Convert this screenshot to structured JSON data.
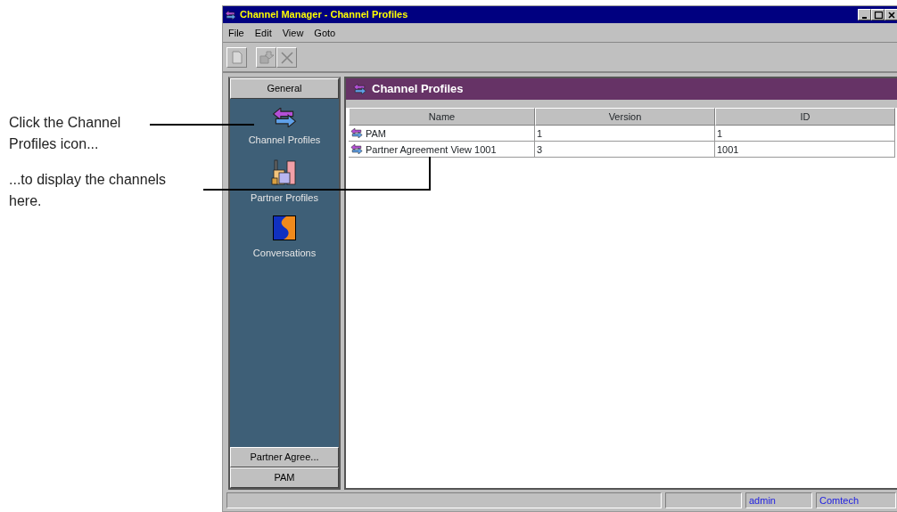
{
  "annotations": [
    {
      "text": "Click the Channel Profiles icon..."
    },
    {
      "text": "...to display the channels here."
    }
  ],
  "window": {
    "title": "Channel Manager - Channel Profiles"
  },
  "menu": [
    "File",
    "Edit",
    "View",
    "Goto"
  ],
  "toolbar": [
    {
      "kind": "new",
      "disabled": true
    },
    {
      "kind": "export",
      "disabled": true
    },
    {
      "kind": "delete",
      "disabled": true
    }
  ],
  "sidebar": {
    "header": "General",
    "items": [
      {
        "label": "Channel Profiles",
        "kind": "channel"
      },
      {
        "label": "Partner Profiles",
        "kind": "partner"
      },
      {
        "label": "Conversations",
        "kind": "conversation"
      }
    ],
    "footer_buttons": [
      "Partner Agree...",
      "PAM"
    ]
  },
  "panel": {
    "title": "Channel Profiles",
    "table": {
      "columns": [
        "Name",
        "Version",
        "ID"
      ],
      "rows": [
        {
          "cells": [
            "PAM",
            "1",
            "1"
          ]
        },
        {
          "cells": [
            "Partner Agreement View 1001",
            "3",
            "1001"
          ]
        }
      ]
    }
  },
  "status_bar": [
    "admin",
    "Comtech"
  ]
}
